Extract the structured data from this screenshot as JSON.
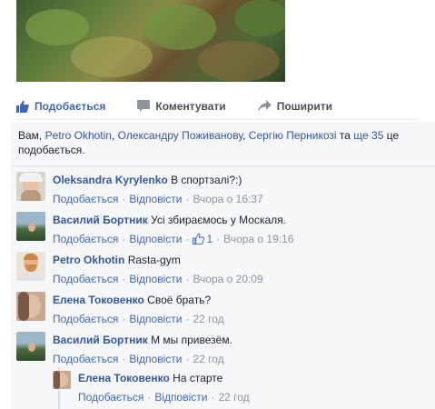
{
  "actions": {
    "like": "Подобається",
    "comment": "Коментувати",
    "share": "Поширити"
  },
  "likes": {
    "prefix": "Вам, ",
    "person1": "Petro Okhotin",
    "sep1": ", ",
    "person2": "Олександру Поживанову",
    "sep2": ", ",
    "person3": "Сергію Перникозі",
    "mid": " та ",
    "others": "ще 35",
    "suffix": " це подобається."
  },
  "comments": [
    {
      "name": "Oleksandra Kyrylenko",
      "text": "В спортзалі?:)",
      "like": "Подобається",
      "reply": "Відповісти",
      "time": "Вчора о 16:37"
    },
    {
      "name": "Василий Бортник",
      "text": "Усі збираємось у Москаля.",
      "like": "Подобається",
      "reply": "Відповісти",
      "reactions": "1",
      "time": "Вчора о 19:16"
    },
    {
      "name": "Petro Okhotin",
      "text": "Rasta-gym",
      "like": "Подобається",
      "reply": "Відповісти",
      "time": "Вчора о 20:09"
    },
    {
      "name": "Елена Токовенко",
      "text": "Своё брать?",
      "like": "Подобається",
      "reply": "Відповісти",
      "time": "22 год"
    },
    {
      "name": "Василий Бортник",
      "text": "М мы привезём.",
      "like": "Подобається",
      "reply": "Відповісти",
      "time": "22 год"
    },
    {
      "name": "Елена Токовенко",
      "text": "На старте",
      "like": "Подобається",
      "reply": "Відповісти",
      "time": "22 год"
    }
  ],
  "sep": "·",
  "icons": {
    "like": "thumbs-up-icon",
    "comment": "speech-bubble-icon",
    "share": "share-arrow-icon"
  },
  "colors": {
    "link": "#365899",
    "accent": "#4267b2",
    "meta": "#90949c",
    "background": "#f6f7f9"
  }
}
